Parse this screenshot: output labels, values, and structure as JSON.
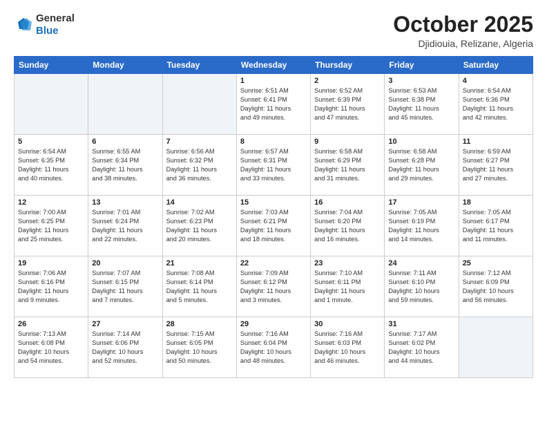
{
  "header": {
    "logo_general": "General",
    "logo_blue": "Blue",
    "month": "October 2025",
    "location": "Djidiouia, Relizane, Algeria"
  },
  "days": [
    "Sunday",
    "Monday",
    "Tuesday",
    "Wednesday",
    "Thursday",
    "Friday",
    "Saturday"
  ],
  "weeks": [
    [
      {
        "num": "",
        "text": ""
      },
      {
        "num": "",
        "text": ""
      },
      {
        "num": "",
        "text": ""
      },
      {
        "num": "1",
        "text": "Sunrise: 6:51 AM\nSunset: 6:41 PM\nDaylight: 11 hours\nand 49 minutes."
      },
      {
        "num": "2",
        "text": "Sunrise: 6:52 AM\nSunset: 6:39 PM\nDaylight: 11 hours\nand 47 minutes."
      },
      {
        "num": "3",
        "text": "Sunrise: 6:53 AM\nSunset: 6:38 PM\nDaylight: 11 hours\nand 45 minutes."
      },
      {
        "num": "4",
        "text": "Sunrise: 6:54 AM\nSunset: 6:36 PM\nDaylight: 11 hours\nand 42 minutes."
      }
    ],
    [
      {
        "num": "5",
        "text": "Sunrise: 6:54 AM\nSunset: 6:35 PM\nDaylight: 11 hours\nand 40 minutes."
      },
      {
        "num": "6",
        "text": "Sunrise: 6:55 AM\nSunset: 6:34 PM\nDaylight: 11 hours\nand 38 minutes."
      },
      {
        "num": "7",
        "text": "Sunrise: 6:56 AM\nSunset: 6:32 PM\nDaylight: 11 hours\nand 36 minutes."
      },
      {
        "num": "8",
        "text": "Sunrise: 6:57 AM\nSunset: 6:31 PM\nDaylight: 11 hours\nand 33 minutes."
      },
      {
        "num": "9",
        "text": "Sunrise: 6:58 AM\nSunset: 6:29 PM\nDaylight: 11 hours\nand 31 minutes."
      },
      {
        "num": "10",
        "text": "Sunrise: 6:58 AM\nSunset: 6:28 PM\nDaylight: 11 hours\nand 29 minutes."
      },
      {
        "num": "11",
        "text": "Sunrise: 6:59 AM\nSunset: 6:27 PM\nDaylight: 11 hours\nand 27 minutes."
      }
    ],
    [
      {
        "num": "12",
        "text": "Sunrise: 7:00 AM\nSunset: 6:25 PM\nDaylight: 11 hours\nand 25 minutes."
      },
      {
        "num": "13",
        "text": "Sunrise: 7:01 AM\nSunset: 6:24 PM\nDaylight: 11 hours\nand 22 minutes."
      },
      {
        "num": "14",
        "text": "Sunrise: 7:02 AM\nSunset: 6:23 PM\nDaylight: 11 hours\nand 20 minutes."
      },
      {
        "num": "15",
        "text": "Sunrise: 7:03 AM\nSunset: 6:21 PM\nDaylight: 11 hours\nand 18 minutes."
      },
      {
        "num": "16",
        "text": "Sunrise: 7:04 AM\nSunset: 6:20 PM\nDaylight: 11 hours\nand 16 minutes."
      },
      {
        "num": "17",
        "text": "Sunrise: 7:05 AM\nSunset: 6:19 PM\nDaylight: 11 hours\nand 14 minutes."
      },
      {
        "num": "18",
        "text": "Sunrise: 7:05 AM\nSunset: 6:17 PM\nDaylight: 11 hours\nand 11 minutes."
      }
    ],
    [
      {
        "num": "19",
        "text": "Sunrise: 7:06 AM\nSunset: 6:16 PM\nDaylight: 11 hours\nand 9 minutes."
      },
      {
        "num": "20",
        "text": "Sunrise: 7:07 AM\nSunset: 6:15 PM\nDaylight: 11 hours\nand 7 minutes."
      },
      {
        "num": "21",
        "text": "Sunrise: 7:08 AM\nSunset: 6:14 PM\nDaylight: 11 hours\nand 5 minutes."
      },
      {
        "num": "22",
        "text": "Sunrise: 7:09 AM\nSunset: 6:12 PM\nDaylight: 11 hours\nand 3 minutes."
      },
      {
        "num": "23",
        "text": "Sunrise: 7:10 AM\nSunset: 6:11 PM\nDaylight: 11 hours\nand 1 minute."
      },
      {
        "num": "24",
        "text": "Sunrise: 7:11 AM\nSunset: 6:10 PM\nDaylight: 10 hours\nand 59 minutes."
      },
      {
        "num": "25",
        "text": "Sunrise: 7:12 AM\nSunset: 6:09 PM\nDaylight: 10 hours\nand 56 minutes."
      }
    ],
    [
      {
        "num": "26",
        "text": "Sunrise: 7:13 AM\nSunset: 6:08 PM\nDaylight: 10 hours\nand 54 minutes."
      },
      {
        "num": "27",
        "text": "Sunrise: 7:14 AM\nSunset: 6:06 PM\nDaylight: 10 hours\nand 52 minutes."
      },
      {
        "num": "28",
        "text": "Sunrise: 7:15 AM\nSunset: 6:05 PM\nDaylight: 10 hours\nand 50 minutes."
      },
      {
        "num": "29",
        "text": "Sunrise: 7:16 AM\nSunset: 6:04 PM\nDaylight: 10 hours\nand 48 minutes."
      },
      {
        "num": "30",
        "text": "Sunrise: 7:16 AM\nSunset: 6:03 PM\nDaylight: 10 hours\nand 46 minutes."
      },
      {
        "num": "31",
        "text": "Sunrise: 7:17 AM\nSunset: 6:02 PM\nDaylight: 10 hours\nand 44 minutes."
      },
      {
        "num": "",
        "text": ""
      }
    ]
  ]
}
